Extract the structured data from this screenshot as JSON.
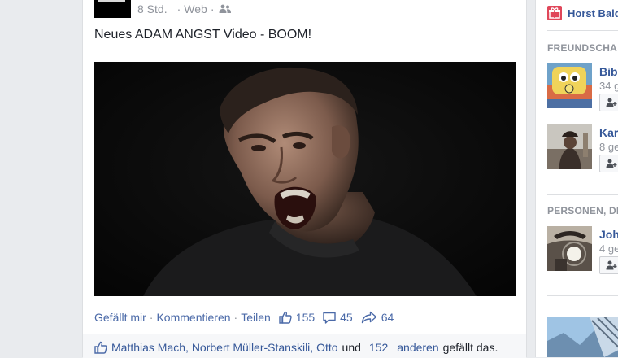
{
  "post": {
    "time": "8 Std.",
    "source": "Web",
    "text": "Neues ADAM ANGST Video - BOOM!",
    "actions": {
      "like": "Gefällt mir",
      "comment": "Kommentieren",
      "share": "Teilen"
    },
    "stats": {
      "likes": "155",
      "comments": "45",
      "shares": "64"
    },
    "likers": {
      "names": "Matthias Mach, Norbert Müller-Stanskili, Otto",
      "and": "und",
      "count": "152",
      "others": "anderen",
      "suffix": "gefällt das."
    }
  },
  "sidebar": {
    "user_name": "Horst Bald",
    "friend_requests_heading": "FREUNDSCHA",
    "people_heading": "PERSONEN, DI",
    "suggestions": [
      {
        "name": "Bibi",
        "sub": "34 g"
      },
      {
        "name": "Kar",
        "sub": "8 ge"
      },
      {
        "name": "Joh",
        "sub": "4 ge"
      }
    ]
  },
  "colors": {
    "link": "#4b6aa8",
    "name_blue": "#365899",
    "meta_gray": "#90949c",
    "background": "#e9ebee"
  },
  "icons": {
    "audience": "friends-icon",
    "like": "thumb-up-icon",
    "comment": "comment-bubble-icon",
    "share": "share-arrow-icon",
    "add_friend": "add-friend-icon",
    "gift": "gift-icon"
  }
}
